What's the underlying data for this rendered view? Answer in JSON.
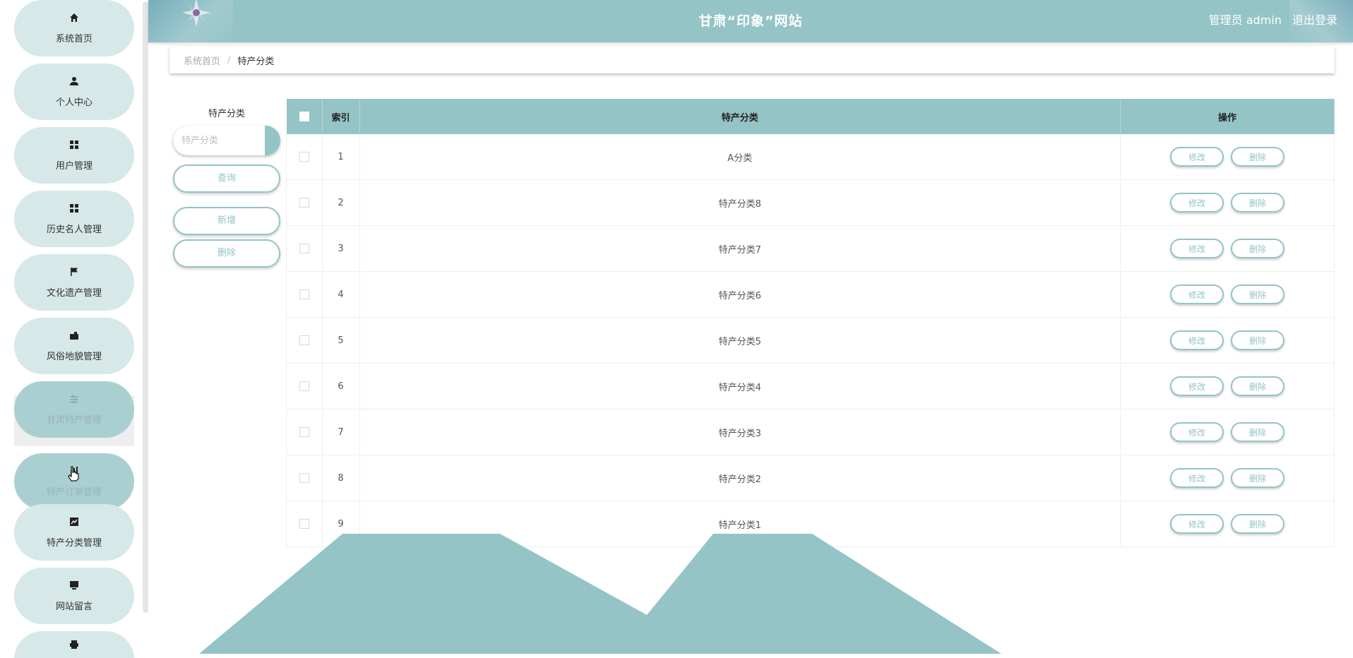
{
  "header": {
    "title": "甘肃“印象”网站",
    "user_label": "管理员 admin",
    "logout_label": "退出登录"
  },
  "sidebar": {
    "items": [
      {
        "label": "系统首页",
        "icon": "home-icon"
      },
      {
        "label": "个人中心",
        "icon": "user-icon"
      },
      {
        "label": "用户管理",
        "icon": "grid-icon"
      },
      {
        "label": "历史名人管理",
        "icon": "grid-icon"
      },
      {
        "label": "文化遗产管理",
        "icon": "flag-icon"
      },
      {
        "label": "风俗地貌管理",
        "icon": "wallet-icon"
      },
      {
        "label": "甘肃特产管理",
        "icon": "sliders-icon"
      },
      {
        "label": "特产订单管理",
        "icon": "chart-bar-icon"
      },
      {
        "label": "特产分类管理",
        "icon": "chart-line-icon"
      },
      {
        "label": "网站留言",
        "icon": "monitor-icon"
      },
      {
        "label": "",
        "icon": "printer-icon"
      }
    ],
    "active_index": 6
  },
  "breadcrumb": {
    "home": "系统首页",
    "separator": "/",
    "current": "特产分类"
  },
  "search": {
    "label": "特产分类",
    "placeholder": "特产分类",
    "query_button": "查询",
    "add_button": "新增",
    "delete_button": "删除"
  },
  "table": {
    "headers": {
      "index": "索引",
      "category": "特产分类",
      "actions": "操作"
    },
    "rows": [
      {
        "index": "1",
        "category": "A分类"
      },
      {
        "index": "2",
        "category": "特产分类8"
      },
      {
        "index": "3",
        "category": "特产分类7"
      },
      {
        "index": "4",
        "category": "特产分类6"
      },
      {
        "index": "5",
        "category": "特产分类5"
      },
      {
        "index": "6",
        "category": "特产分类4"
      },
      {
        "index": "7",
        "category": "特产分类3"
      },
      {
        "index": "8",
        "category": "特产分类2"
      },
      {
        "index": "9",
        "category": "特产分类1"
      }
    ],
    "edit_label": "修改",
    "delete_label": "删除"
  },
  "colors": {
    "accent": "#94c4c6",
    "menu_bg": "#d6e8e8",
    "menu_active": "#a9cfd1"
  }
}
